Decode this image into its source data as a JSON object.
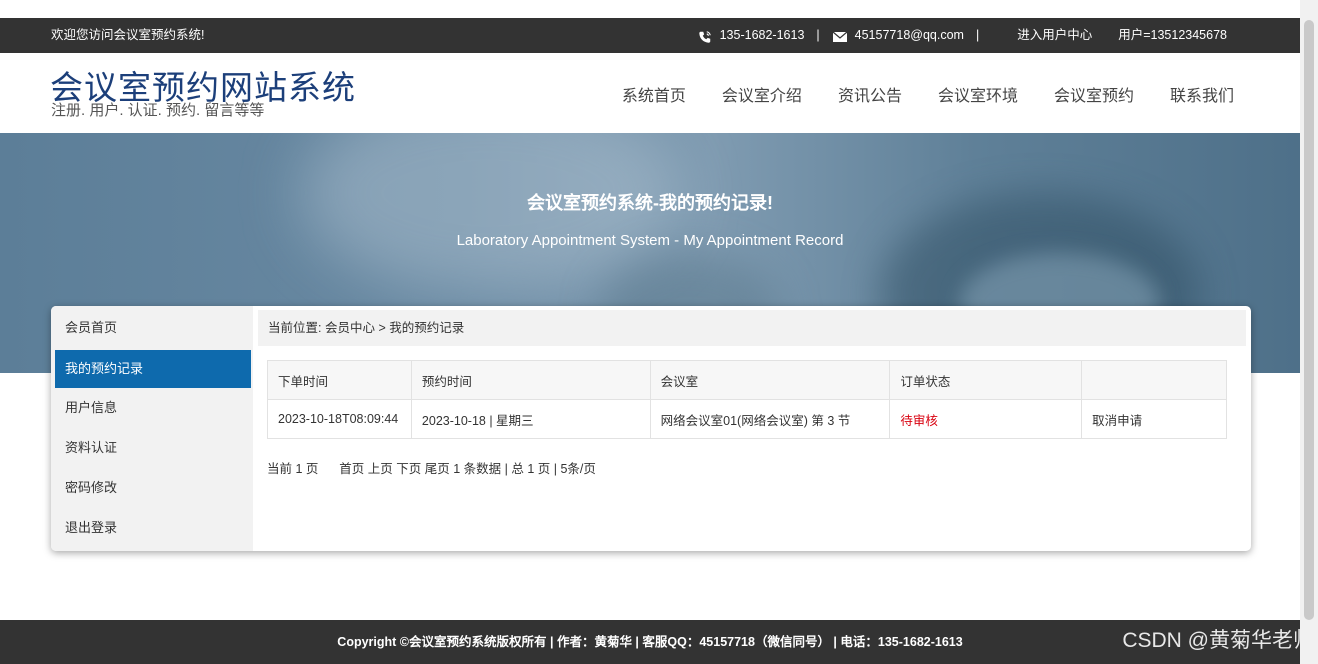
{
  "topbar": {
    "welcome": "欢迎您访问会议室预约系统!",
    "phone": "135-1682-1613",
    "email": "45157718@qq.com",
    "separator": "|",
    "user_center": "进入用户中心",
    "user": "用户=13512345678"
  },
  "header": {
    "title": "会议室预约网站系统",
    "subtitle": "注册. 用户. 认证. 预约. 留言等等",
    "nav": [
      "系统首页",
      "会议室介绍",
      "资讯公告",
      "会议室环境",
      "会议室预约",
      "联系我们"
    ]
  },
  "banner": {
    "title": "会议室预约系统-我的预约记录!",
    "subtitle": "Laboratory Appointment System - My Appointment Record"
  },
  "sidebar": {
    "items": [
      {
        "label": "会员首页",
        "active": false
      },
      {
        "label": "我的预约记录",
        "active": true
      },
      {
        "label": "用户信息",
        "active": false
      },
      {
        "label": "资料认证",
        "active": false
      },
      {
        "label": "密码修改",
        "active": false
      },
      {
        "label": "退出登录",
        "active": false
      }
    ]
  },
  "breadcrumb": {
    "prefix": "当前位置:",
    "parent": "会员中心",
    "sep": ">",
    "current": "我的预约记录"
  },
  "table": {
    "headers": [
      "下单时间",
      "预约时间",
      "会议室",
      "订单状态",
      ""
    ],
    "rows": [
      {
        "order_time": "2023-10-18T08:09:44",
        "appointment_time": "2023-10-18 | 星期三",
        "room": "网络会议室01(网络会议室) 第 3 节",
        "status": "待审核",
        "action": "取消申请"
      }
    ]
  },
  "pager": {
    "current": "当前 1 页",
    "first": "首页",
    "prev": "上页",
    "next": "下页",
    "last": "尾页",
    "summary": "1 条数据 | 总 1 页 | 5条/页"
  },
  "footer": {
    "text": "Copyright ©会议室预约系统版权所有 | 作者：黄菊华 | 客服QQ：45157718（微信同号） | 电话：135-1682-1613"
  },
  "watermark": "CSDN @黄菊华老师",
  "colors": {
    "topbar": "#333333",
    "title": "#1c3f7a",
    "active_menu": "#0e6aad",
    "status_pending": "#d9000f"
  }
}
